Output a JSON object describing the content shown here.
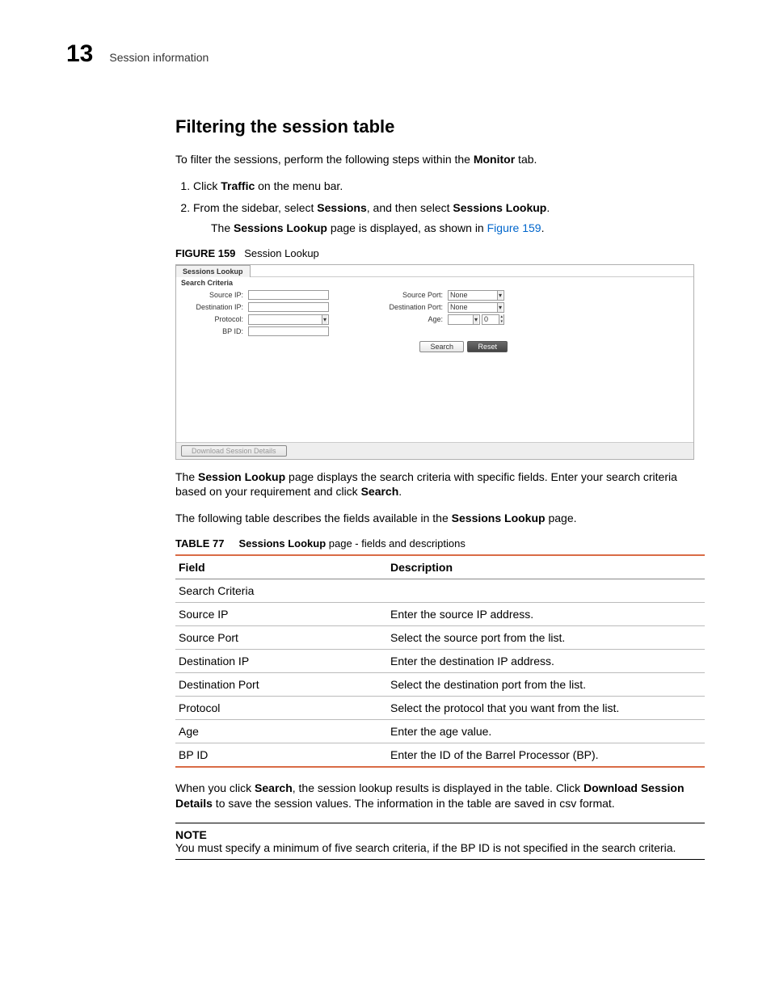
{
  "header": {
    "chapter_number": "13",
    "section_path": "Session information"
  },
  "heading": "Filtering the session table",
  "intro": {
    "prefix": "To filter the sessions, perform the following steps within the ",
    "bold": "Monitor",
    "suffix": " tab."
  },
  "steps": {
    "s1_pre": "Click ",
    "s1_bold": "Traffic",
    "s1_post": " on the menu bar.",
    "s2_pre": "From the sidebar, select ",
    "s2_b1": "Sessions",
    "s2_mid": ", and then select ",
    "s2_b2": "Sessions Lookup",
    "s2_post": ".",
    "s2_sub_pre": "The ",
    "s2_sub_bold": "Sessions Lookup",
    "s2_sub_mid": " page is displayed, as shown in ",
    "s2_sub_link": "Figure 159",
    "s2_sub_post": "."
  },
  "figure": {
    "label": "FIGURE 159",
    "caption": "Session Lookup",
    "tab_title": "Sessions Lookup",
    "fieldset": "Search Criteria",
    "labels": {
      "source_ip": "Source IP:",
      "dest_ip": "Destination IP:",
      "protocol": "Protocol:",
      "bp_id": "BP ID:",
      "source_port": "Source Port:",
      "dest_port": "Destination Port:",
      "age": "Age:"
    },
    "values": {
      "source_port": "None",
      "dest_port": "None",
      "age_spin": "0"
    },
    "buttons": {
      "search": "Search",
      "reset": "Reset",
      "download": "Download Session Details"
    }
  },
  "after_figure": {
    "p1_pre": "The ",
    "p1_b1": "Session Lookup",
    "p1_mid": " page displays the search criteria with specific fields. Enter your search criteria based on your requirement and click ",
    "p1_b2": "Search",
    "p1_post": ".",
    "p2_pre": "The following table describes the fields available in the ",
    "p2_b": "Sessions Lookup",
    "p2_post": " page."
  },
  "table": {
    "label": "TABLE 77",
    "caption_b": "Sessions Lookup",
    "caption_rest": " page - fields and descriptions",
    "head_field": "Field",
    "head_desc": "Description",
    "rows": [
      {
        "f": "Search Criteria",
        "d": ""
      },
      {
        "f": "Source IP",
        "d": "Enter the source IP address."
      },
      {
        "f": "Source Port",
        "d": "Select the source port from the list."
      },
      {
        "f": "Destination IP",
        "d": "Enter the destination IP address."
      },
      {
        "f": "Destination Port",
        "d": "Select the destination port from the list."
      },
      {
        "f": "Protocol",
        "d": "Select the protocol that you want from the list."
      },
      {
        "f": "Age",
        "d": "Enter the age value."
      },
      {
        "f": "BP ID",
        "d": "Enter the ID of the Barrel Processor (BP)."
      }
    ]
  },
  "after_table": {
    "pre": "When you click ",
    "b1": "Search",
    "mid": ", the session lookup results is displayed in the table. Click ",
    "b2": "Download Session Details",
    "post": " to save the session values. The information in the table are saved in csv format."
  },
  "note": {
    "title": "NOTE",
    "text": "You must specify a minimum of five search criteria, if the BP ID is not specified in the search criteria."
  }
}
